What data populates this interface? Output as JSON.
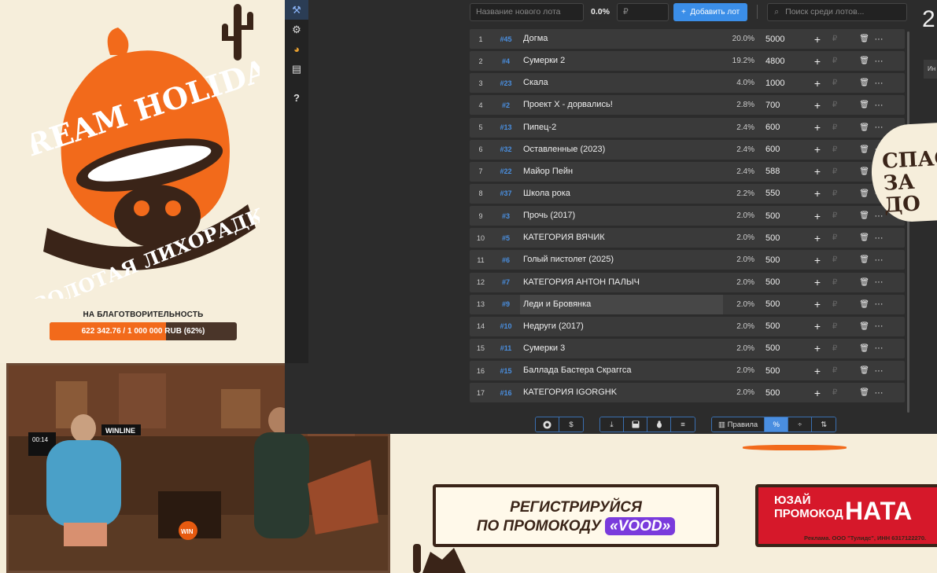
{
  "overlay": {
    "logo_text_top": "STREAM HOLIDAYS",
    "logo_text_bottom": "ЗОЛОТАЯ ЛИХОРАДКА",
    "charity_label": "НА БЛАГОТВОРИТЕЛЬНОСТЬ",
    "charity_progress_text": "622 342.76 / 1 000 000 RUB (62%)",
    "charity_progress_fraction": 0.62,
    "colors": {
      "orange": "#f26a1b",
      "brown": "#4a3529"
    }
  },
  "webcam": {
    "overlay_time": "00:14",
    "sign_text": "WINLINE",
    "table_logo": "WIN"
  },
  "sidebar": {
    "items": [
      {
        "icon": "gavel-icon",
        "glyph": "⚒"
      },
      {
        "icon": "gear-icon",
        "glyph": "⚙"
      },
      {
        "icon": "pie-chart-icon",
        "glyph": "◕"
      },
      {
        "icon": "clipboard-icon",
        "glyph": "▤"
      },
      {
        "icon": "help-icon",
        "glyph": "?"
      }
    ]
  },
  "toolbar": {
    "new_lot_placeholder": "Название нового лота",
    "percent": "0.0%",
    "amount_placeholder": "₽",
    "add_label": "Добавить лот",
    "add_icon": "+",
    "search_placeholder": "Поиск среди лотов...",
    "search_icon": "⌕"
  },
  "lots": [
    {
      "n": "1",
      "id": "#45",
      "name": "Догма",
      "pct": "20.0%",
      "amt": "5000"
    },
    {
      "n": "2",
      "id": "#4",
      "name": "Сумерки 2",
      "pct": "19.2%",
      "amt": "4800"
    },
    {
      "n": "3",
      "id": "#23",
      "name": "Скала",
      "pct": "4.0%",
      "amt": "1000"
    },
    {
      "n": "4",
      "id": "#2",
      "name": "Проект X - дорвались!",
      "pct": "2.8%",
      "amt": "700"
    },
    {
      "n": "5",
      "id": "#13",
      "name": "Пипец-2",
      "pct": "2.4%",
      "amt": "600"
    },
    {
      "n": "6",
      "id": "#32",
      "name": "Оставленные (2023)",
      "pct": "2.4%",
      "amt": "600"
    },
    {
      "n": "7",
      "id": "#22",
      "name": "Майор Пейн",
      "pct": "2.4%",
      "amt": "588"
    },
    {
      "n": "8",
      "id": "#37",
      "name": "Школа рока",
      "pct": "2.2%",
      "amt": "550"
    },
    {
      "n": "9",
      "id": "#3",
      "name": "Прочь (2017)",
      "pct": "2.0%",
      "amt": "500"
    },
    {
      "n": "10",
      "id": "#5",
      "name": "КАТЕГОРИЯ ВЯЧИК",
      "pct": "2.0%",
      "amt": "500"
    },
    {
      "n": "11",
      "id": "#6",
      "name": "Голый пистолет (2025)",
      "pct": "2.0%",
      "amt": "500"
    },
    {
      "n": "12",
      "id": "#7",
      "name": "КАТЕГОРИЯ АНТОН ПАЛЫЧ",
      "pct": "2.0%",
      "amt": "500"
    },
    {
      "n": "13",
      "id": "#9",
      "name": "Леди и Бровянка",
      "pct": "2.0%",
      "amt": "500"
    },
    {
      "n": "14",
      "id": "#10",
      "name": "Недруги (2017)",
      "pct": "2.0%",
      "amt": "500"
    },
    {
      "n": "15",
      "id": "#11",
      "name": "Сумерки 3",
      "pct": "2.0%",
      "amt": "500"
    },
    {
      "n": "16",
      "id": "#15",
      "name": "Баллада Бастера Скраггса",
      "pct": "2.0%",
      "amt": "500"
    },
    {
      "n": "17",
      "id": "#16",
      "name": "КАТЕГОРИЯ IGORGHK",
      "pct": "2.0%",
      "amt": "500"
    }
  ],
  "lot_actions": {
    "plus": "+",
    "currency": "₽",
    "trash": "🗑",
    "more": "···"
  },
  "bottombar": {
    "group1": [
      "",
      "$"
    ],
    "group2": [
      "⤓",
      "💾",
      "☻",
      "≡"
    ],
    "rules_label": "Правила",
    "percent_btn": "%",
    "group3_rest": [
      "÷",
      "⇅"
    ]
  },
  "rightpeek": {
    "timer": "2",
    "btn": "Ин"
  },
  "spas_text": [
    "СПАС",
    "ЗА ДО"
  ],
  "ads": {
    "promo1_line1": "РЕГИСТРИРУЙСЯ",
    "promo1_line2": "ПО ПРОМОКОДУ",
    "promo1_code": "«VOOD»",
    "promo2_line1": "ЮЗАЙ",
    "promo2_line2": "ПРОМОКОД",
    "promo2_code": "НАТА",
    "legal": "Реклама. ООО \"Тулидс\", ИНН 6317122270."
  }
}
